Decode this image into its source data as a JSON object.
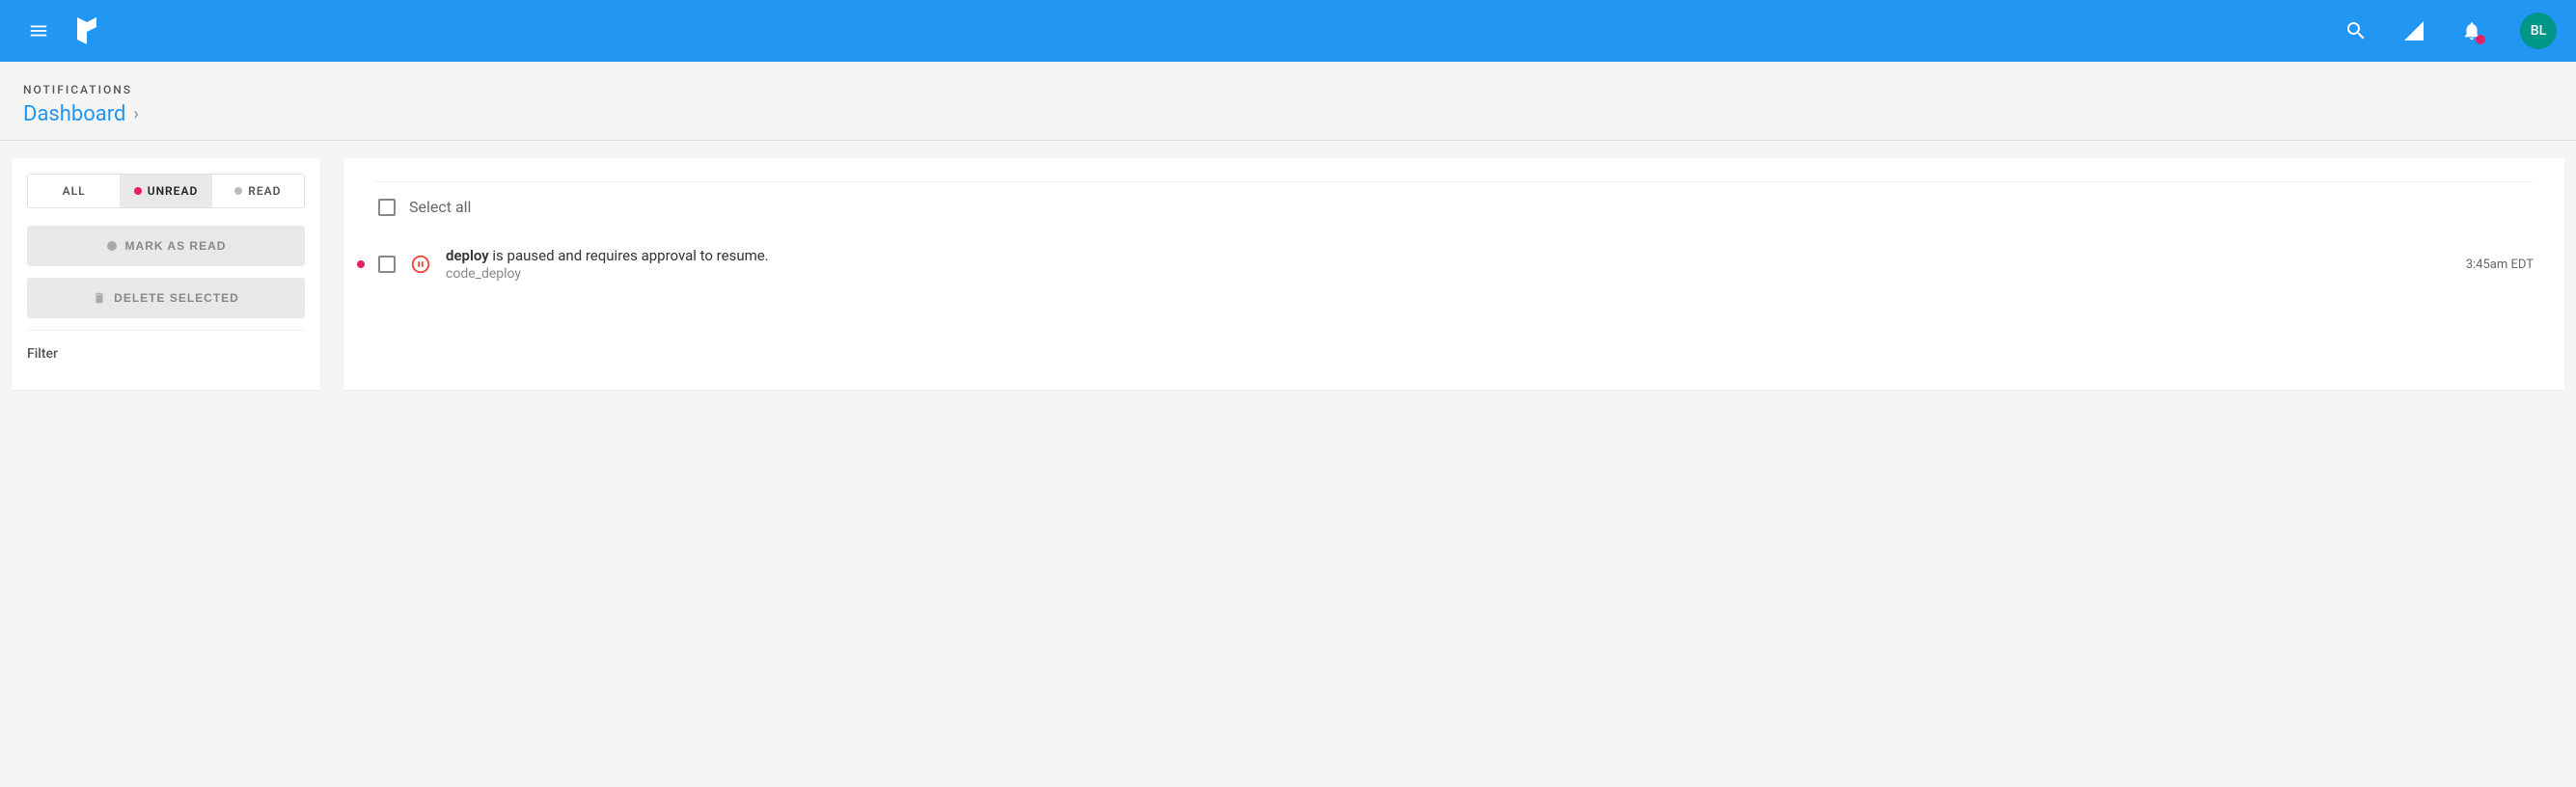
{
  "topbar": {
    "avatar_initials": "BL"
  },
  "header": {
    "section_label": "NOTIFICATIONS",
    "breadcrumb_link": "Dashboard"
  },
  "sidebar": {
    "tabs": {
      "all": "ALL",
      "unread": "UNREAD",
      "read": "READ"
    },
    "actions": {
      "mark_read": "MARK AS READ",
      "delete": "DELETE SELECTED"
    },
    "filter_label": "Filter"
  },
  "main": {
    "select_all_label": "Select all",
    "notifications": [
      {
        "subject": "deploy",
        "message": " is paused and requires approval to resume.",
        "subtitle": "code_deploy",
        "time": "3:45am EDT"
      }
    ]
  },
  "colors": {
    "primary": "#2196f3",
    "accent": "#e91e63",
    "avatar_bg": "#009688"
  }
}
